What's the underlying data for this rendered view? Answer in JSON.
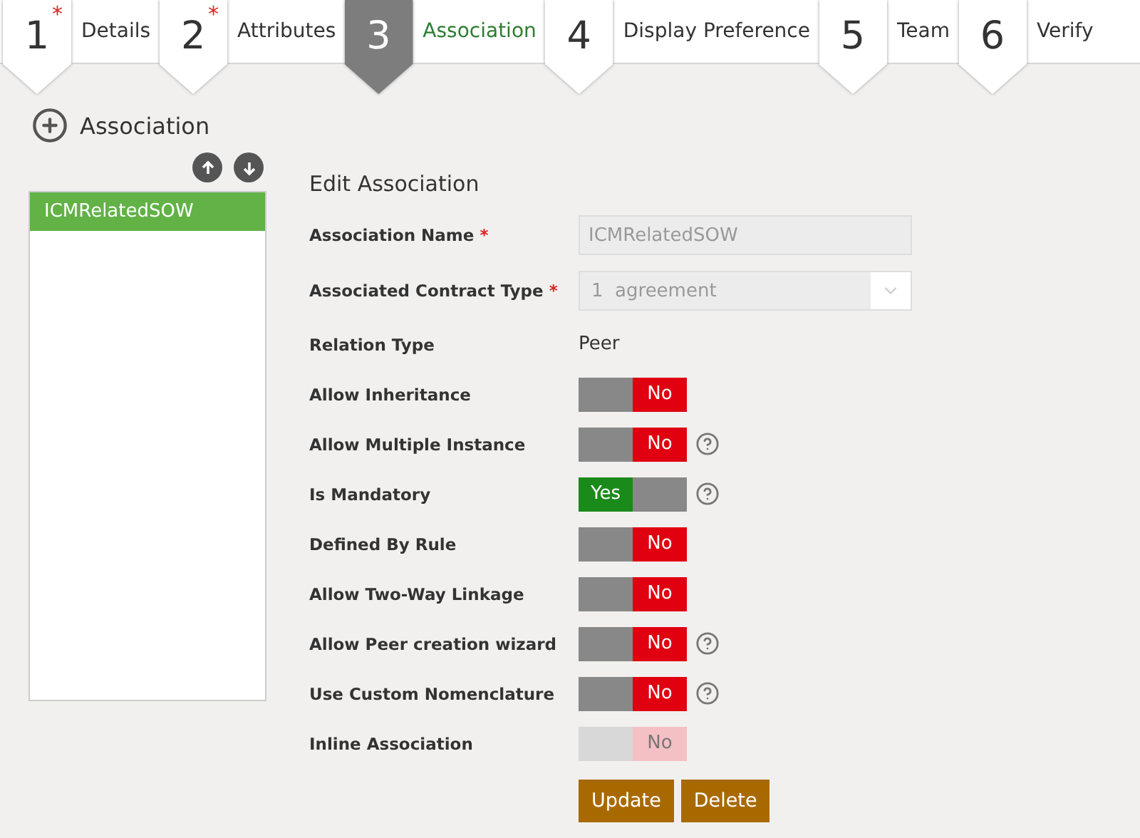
{
  "steps": [
    {
      "number": "1",
      "required_mark": "*",
      "label": "Details",
      "selected": false
    },
    {
      "number": "2",
      "required_mark": "*",
      "label": "Attributes",
      "selected": false
    },
    {
      "number": "3",
      "label": "Association",
      "selected": true
    },
    {
      "number": "4",
      "label": "Display Preference",
      "selected": false
    },
    {
      "number": "5",
      "label": "Team",
      "selected": false
    },
    {
      "number": "6",
      "label": "Verify",
      "selected": false
    }
  ],
  "sidebar": {
    "title": "Association",
    "items": [
      {
        "label": "ICMRelatedSOW",
        "selected": true
      }
    ]
  },
  "form": {
    "title": "Edit Association",
    "fields": [
      {
        "kind": "text",
        "label": "Association Name",
        "required_mark": "*",
        "value": "ICMRelatedSOW",
        "disabled": true
      },
      {
        "kind": "select",
        "label": "Associated Contract Type",
        "required_mark": "*",
        "value": "1  agreement",
        "disabled": true
      },
      {
        "kind": "static",
        "label": "Relation Type",
        "value": "Peer"
      },
      {
        "kind": "toggle",
        "label": "Allow Inheritance",
        "on": false,
        "disabled": false,
        "text": "No",
        "help": false
      },
      {
        "kind": "toggle",
        "label": "Allow Multiple Instance",
        "on": false,
        "disabled": false,
        "text": "No",
        "help": true
      },
      {
        "kind": "toggle",
        "label": "Is Mandatory",
        "on": true,
        "disabled": false,
        "text": "Yes",
        "help": true
      },
      {
        "kind": "toggle",
        "label": "Defined By Rule",
        "on": false,
        "disabled": false,
        "text": "No",
        "help": false
      },
      {
        "kind": "toggle",
        "label": "Allow Two-Way Linkage",
        "on": false,
        "disabled": false,
        "text": "No",
        "help": false
      },
      {
        "kind": "toggle",
        "label": "Allow Peer creation wizard",
        "on": false,
        "disabled": false,
        "text": "No",
        "help": true
      },
      {
        "kind": "toggle",
        "label": "Use Custom Nomenclature",
        "on": false,
        "disabled": false,
        "text": "No",
        "help": true
      },
      {
        "kind": "toggle",
        "label": "Inline Association",
        "on": false,
        "disabled": true,
        "text": "No",
        "help": false
      }
    ],
    "buttons": [
      "Update",
      "Delete"
    ]
  }
}
